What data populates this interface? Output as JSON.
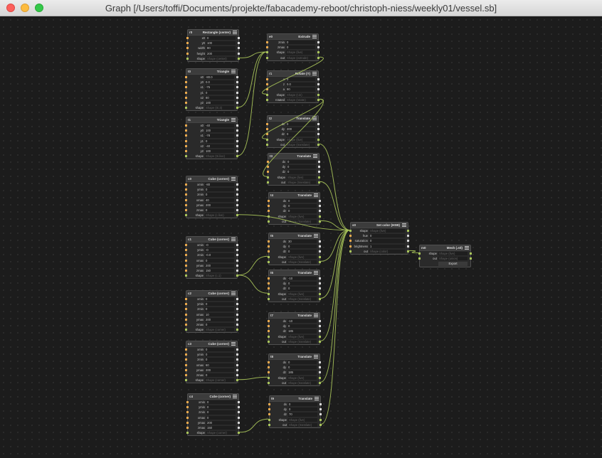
{
  "window": {
    "title": "Graph [/Users/toffi/Documents/projekte/fabacademy-reboot/christoph-niess/weekly01/vessel.sb]"
  },
  "colors": {
    "canvas": "#1c1c1c",
    "node": "#2a2a2a",
    "wire": "#a8c45a",
    "number_port": "#e8a84c"
  },
  "nodes": [
    {
      "id": "r0",
      "title": "Rectangle (center)",
      "params": [
        [
          "x0",
          "0"
        ],
        [
          "y0",
          "100"
        ],
        [
          "width",
          "80"
        ],
        [
          "height",
          "200"
        ],
        [
          "shape",
          "Shape (center)"
        ]
      ]
    },
    {
      "id": "t0",
      "title": "Triangle",
      "params": [
        [
          "x0",
          "-80.0"
        ],
        [
          "y0",
          "0.0"
        ],
        [
          "x1",
          "-75"
        ],
        [
          "y1",
          "0"
        ],
        [
          "x2",
          "80"
        ],
        [
          "y2",
          "100"
        ],
        [
          "shape",
          "Shape (tri.3)"
        ]
      ]
    },
    {
      "id": "t1",
      "title": "Triangle",
      "params": [
        [
          "x0",
          "-40"
        ],
        [
          "y0",
          "100"
        ],
        [
          "x1",
          "-78"
        ],
        [
          "y1",
          "0"
        ],
        [
          "x2",
          "-40"
        ],
        [
          "y2",
          "100"
        ],
        [
          "shape",
          "Shape (tri.live)"
        ]
      ]
    },
    {
      "id": "c0",
      "title": "Cube (corner)",
      "params": [
        [
          "xmin",
          "-80"
        ],
        [
          "ymin",
          "0"
        ],
        [
          "zmin",
          "0"
        ],
        [
          "xmax",
          "40"
        ],
        [
          "ymax",
          "200"
        ],
        [
          "zmax",
          "0"
        ],
        [
          "shape",
          "Shape (c.live)"
        ]
      ]
    },
    {
      "id": "c1",
      "title": "Cube (corner)",
      "params": [
        [
          "xmin",
          "-0"
        ],
        [
          "ymin",
          "-0"
        ],
        [
          "zmin",
          "-0.0"
        ],
        [
          "xmax",
          "0"
        ],
        [
          "ymax",
          "200"
        ],
        [
          "zmax",
          "150"
        ],
        [
          "shape",
          "Shape (c.1)"
        ]
      ]
    },
    {
      "id": "c2",
      "title": "Cube (corner)",
      "params": [
        [
          "xmin",
          "0"
        ],
        [
          "ymin",
          "0"
        ],
        [
          "zmin",
          "0"
        ],
        [
          "xmax",
          "10"
        ],
        [
          "ymax",
          "200"
        ],
        [
          "zmax",
          "0"
        ],
        [
          "shape",
          "Shape (corner)"
        ]
      ]
    },
    {
      "id": "c3",
      "title": "Cube (corner)",
      "params": [
        [
          "xmin",
          "0"
        ],
        [
          "ymin",
          "0"
        ],
        [
          "zmin",
          "0"
        ],
        [
          "xmax",
          "60"
        ],
        [
          "ymax",
          "200"
        ],
        [
          "zmax",
          "0"
        ],
        [
          "shape",
          "Shape (corner)"
        ]
      ]
    },
    {
      "id": "c4",
      "title": "Cube (corner)",
      "params": [
        [
          "xmin",
          "0"
        ],
        [
          "ymin",
          "0"
        ],
        [
          "zmin",
          "0"
        ],
        [
          "xmax",
          "0"
        ],
        [
          "ymax",
          "200"
        ],
        [
          "zmax",
          "150"
        ],
        [
          "shape",
          "Shape (corner)"
        ]
      ]
    },
    {
      "id": "e0",
      "title": "Extrude",
      "params": [
        [
          "zmin",
          "0"
        ],
        [
          "zmax",
          "0"
        ],
        [
          "shape",
          "Shape (live)"
        ],
        [
          "out",
          "Shape (extrude)"
        ]
      ]
    },
    {
      "id": "r1",
      "title": "Rotate (Y)",
      "params": [
        [
          "x",
          "0"
        ],
        [
          "z",
          "0.0"
        ],
        [
          "a",
          "90"
        ],
        [
          "shape",
          "Shape (r.in)"
        ],
        [
          "rotated",
          "Shape (rotate)"
        ]
      ]
    },
    {
      "id": "t2",
      "title": "Translate",
      "params": [
        [
          "dx",
          "0"
        ],
        [
          "dy",
          "200"
        ],
        [
          "dz",
          "0"
        ],
        [
          "shape",
          "Shape (live)"
        ],
        [
          "out",
          "Shape (translate)"
        ]
      ]
    },
    {
      "id": "t3",
      "title": "Translate",
      "params": [
        [
          "dx",
          "0"
        ],
        [
          "dy",
          "0"
        ],
        [
          "dz",
          "0"
        ],
        [
          "shape",
          "Shape (live)"
        ],
        [
          "out",
          "Shape (translate)"
        ]
      ]
    },
    {
      "id": "t4",
      "title": "Translate",
      "params": [
        [
          "dx",
          "0"
        ],
        [
          "dy",
          "0"
        ],
        [
          "dz",
          "0"
        ],
        [
          "shape",
          "Shape (live)"
        ],
        [
          "out",
          "Shape (translate)"
        ]
      ]
    },
    {
      "id": "t5",
      "title": "Translate",
      "params": [
        [
          "dx",
          "30"
        ],
        [
          "dy",
          "0"
        ],
        [
          "dz",
          "0"
        ],
        [
          "shape",
          "Shape (live)"
        ],
        [
          "out",
          "Shape (translate)"
        ]
      ]
    },
    {
      "id": "t6",
      "title": "Translate",
      "params": [
        [
          "dx",
          "-10"
        ],
        [
          "dy",
          "0"
        ],
        [
          "dz",
          "0"
        ],
        [
          "shape",
          "Shape (live)"
        ],
        [
          "out",
          "Shape (translate)"
        ]
      ]
    },
    {
      "id": "t7",
      "title": "Translate",
      "params": [
        [
          "dx",
          "-10"
        ],
        [
          "dy",
          "0"
        ],
        [
          "dz",
          "185"
        ],
        [
          "shape",
          "Shape (live)"
        ],
        [
          "out",
          "Shape (translate)"
        ]
      ]
    },
    {
      "id": "t8",
      "title": "Translate",
      "params": [
        [
          "dx",
          "0"
        ],
        [
          "dy",
          "0"
        ],
        [
          "dz",
          "185"
        ],
        [
          "shape",
          "Shape (live)"
        ],
        [
          "out",
          "Shape (translate)"
        ]
      ]
    },
    {
      "id": "t9",
      "title": "Translate",
      "params": [
        [
          "dx",
          "0"
        ],
        [
          "dy",
          "0"
        ],
        [
          "dz",
          "70"
        ],
        [
          "shape",
          "Shape (live)"
        ],
        [
          "out",
          "Shape (translate)"
        ]
      ]
    },
    {
      "id": "s0",
      "title": "Set color (HSB)",
      "params": [
        [
          "shape",
          "Shape (live)"
        ],
        [
          "hue",
          "0"
        ],
        [
          "saturation",
          "0"
        ],
        [
          "brightness",
          "1"
        ],
        [
          "out",
          "Shape (color)"
        ]
      ]
    },
    {
      "id": "m0",
      "title": "Mesh (.stl)",
      "params": [
        [
          "shape",
          "Shape (live)"
        ],
        [
          "out",
          "Shape (union)"
        ]
      ],
      "button": "Export"
    }
  ]
}
